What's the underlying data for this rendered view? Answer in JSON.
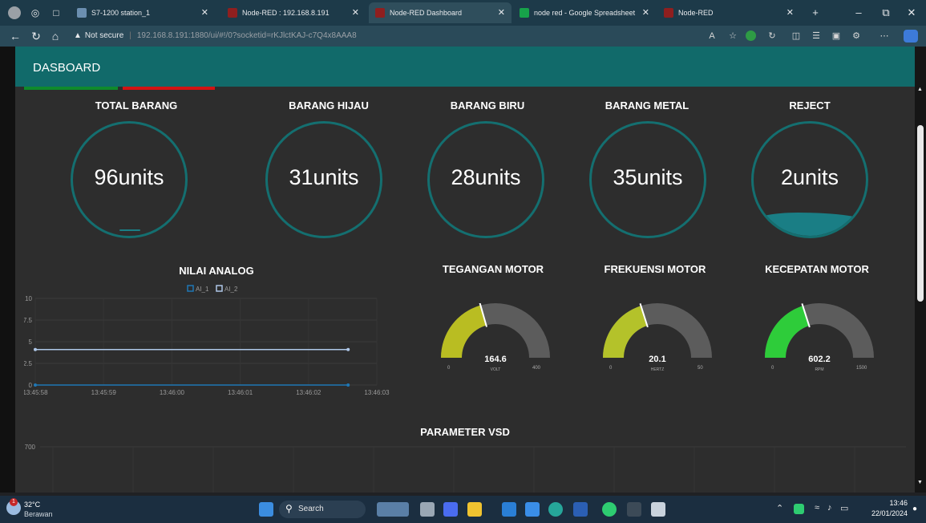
{
  "browser": {
    "tabs": [
      {
        "title": "S7-1200 station_1",
        "fav_color": "#6b8fb0"
      },
      {
        "title": "Node-RED : 192.168.8.191",
        "fav_color": "#8f1f1f"
      },
      {
        "title": "Node-RED Dashboard",
        "fav_color": "#8f1f1f"
      },
      {
        "title": "node red - Google Spreadsheet",
        "fav_color": "#17a34a"
      },
      {
        "title": "Node-RED",
        "fav_color": "#8f1f1f"
      }
    ],
    "new_tab": "+",
    "not_secure": "Not secure",
    "url": "192.168.8.191:1880/ui/#!/0?socketid=rKJlctKAJ-c7Q4x8AAA8"
  },
  "header": {
    "title": "DASBOARD"
  },
  "counters": [
    {
      "label": "TOTAL BARANG",
      "value": "96units",
      "fill": 0.02
    },
    {
      "label": "BARANG HIJAU",
      "value": "31units",
      "fill": 0
    },
    {
      "label": "BARANG BIRU",
      "value": "28units",
      "fill": 0
    },
    {
      "label": "BARANG METAL",
      "value": "35units",
      "fill": 0
    },
    {
      "label": "REJECT",
      "value": "2units",
      "fill": 0.2
    }
  ],
  "gauges": [
    {
      "label": "TEGANGAN MOTOR",
      "value": "164.6",
      "unit": "VOLT",
      "min": "0",
      "max": "400",
      "level": 0.4115,
      "color": "#b9bd22"
    },
    {
      "label": "FREKUENSI MOTOR",
      "value": "20.1",
      "unit": "HERTZ",
      "min": "0",
      "max": "50",
      "level": 0.402,
      "color": "#b4c22a"
    },
    {
      "label": "KECEPATAN MOTOR",
      "value": "602.2",
      "unit": "RPM",
      "min": "0",
      "max": "1500",
      "level": 0.4015,
      "color": "#2ecc3a"
    }
  ],
  "analog": {
    "title": "NILAI ANALOG",
    "chart_data": {
      "type": "line",
      "title": "NILAI ANALOG",
      "x": [
        "13:45:58",
        "13:45:59",
        "13:46:00",
        "13:46:01",
        "13:46:02",
        "13:46:03"
      ],
      "yticks": [
        "10",
        "7.5",
        "5",
        "2.5",
        "0"
      ],
      "ylim": [
        0,
        10
      ],
      "series": [
        {
          "name": "AI_1",
          "color": "#1f77b4",
          "values": [
            0,
            0
          ]
        },
        {
          "name": "AI_2",
          "color": "#aec7e8",
          "values": [
            4.1,
            4.1
          ]
        }
      ],
      "x_points": [
        0,
        4.58
      ],
      "grid": true,
      "legend": "top-center"
    }
  },
  "vsd": {
    "title": "PARAMETER VSD",
    "chart_data": {
      "type": "line",
      "title": "PARAMETER VSD",
      "yticks": [
        "700"
      ],
      "grid": true
    }
  },
  "taskbar": {
    "temp": "32°C",
    "weather": "Berawan",
    "badge": "1",
    "search": "Search",
    "time": "13:46",
    "date": "22/01/2024"
  }
}
